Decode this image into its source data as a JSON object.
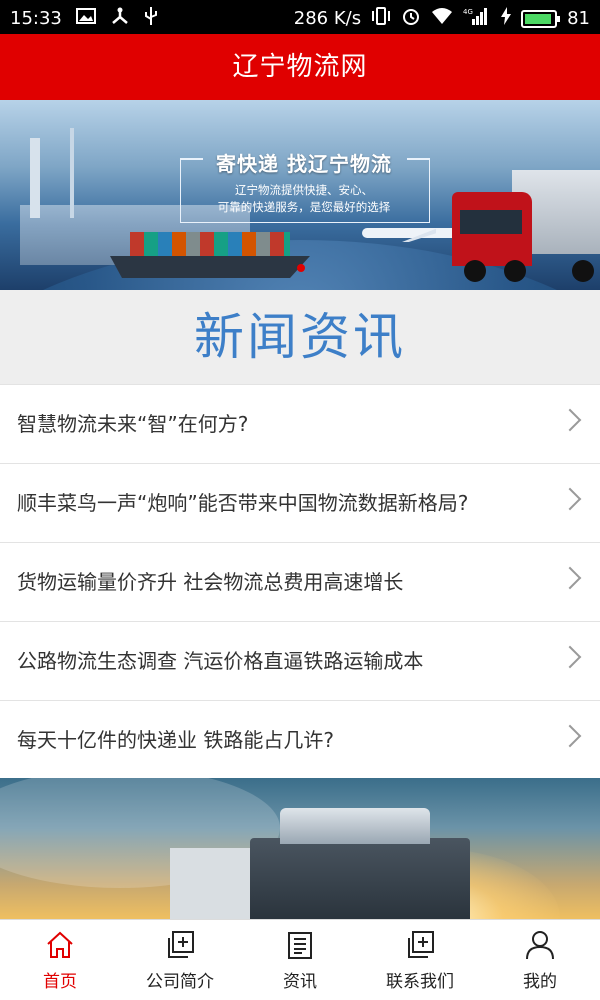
{
  "status_bar": {
    "time": "15:33",
    "speed": "286 K/s",
    "battery": "81",
    "network": "4G",
    "icons": [
      "image-icon",
      "usb-debug-icon",
      "usb-icon",
      "vibrate-icon",
      "alarm-icon",
      "wifi-icon",
      "signal-icon",
      "charging-icon",
      "battery-icon"
    ]
  },
  "header": {
    "title": "辽宁物流网"
  },
  "banner": {
    "headline": "寄快递  找辽宁物流",
    "subtitle_line1": "辽宁物流提供快捷、安心、",
    "subtitle_line2": "可靠的快递服务，是您最好的选择"
  },
  "news": {
    "section_title": "新闻资讯",
    "items": [
      {
        "title": "智慧物流未来“智”在何方?"
      },
      {
        "title": "顺丰菜鸟一声“炮响”能否带来中国物流数据新格局?"
      },
      {
        "title": "货物运输量价齐升 社会物流总费用高速增长"
      },
      {
        "title": "公路物流生态调查 汽运价格直逼铁路运输成本"
      },
      {
        "title": "每天十亿件的快递业 铁路能占几许?"
      }
    ]
  },
  "bottom_nav": {
    "accent_color": "#e00000",
    "items": [
      {
        "label": "首页",
        "icon": "home-icon",
        "active": true
      },
      {
        "label": "公司简介",
        "icon": "add-square-icon"
      },
      {
        "label": "资讯",
        "icon": "document-icon"
      },
      {
        "label": "联系我们",
        "icon": "add-square-icon"
      },
      {
        "label": "我的",
        "icon": "user-icon"
      }
    ]
  }
}
